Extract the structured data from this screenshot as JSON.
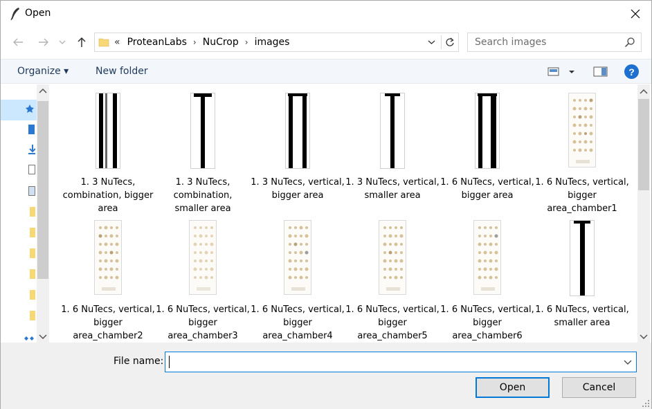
{
  "window": {
    "title": "Open",
    "app_icon": "feather-icon",
    "close_icon": "close-icon"
  },
  "address": {
    "prefix": "«",
    "crumbs": [
      "ProteanLabs",
      "NuCrop",
      "images"
    ],
    "separator": "›"
  },
  "search": {
    "placeholder": "Search images"
  },
  "toolbar": {
    "organize_label": "Organize ▾",
    "new_folder_label": "New folder",
    "help_label": "?"
  },
  "files": [
    {
      "name": "1. 3 NuTecs, combination, bigger area",
      "thumb": "double-bar"
    },
    {
      "name": "1. 3 NuTecs, combination, smaller area",
      "thumb": "single-bar"
    },
    {
      "name": "1. 3 NuTecs, vertical, bigger area",
      "thumb": "double-bar"
    },
    {
      "name": "1. 3 NuTecs, vertical, smaller area",
      "thumb": "single-bar"
    },
    {
      "name": "1. 6 NuTecs, vertical, bigger area",
      "thumb": "double-bar"
    },
    {
      "name": "1. 6 NuTecs, vertical, bigger area_chamber1",
      "thumb": "dots"
    },
    {
      "name": "1. 6 NuTecs, vertical, bigger area_chamber2",
      "thumb": "dots"
    },
    {
      "name": "1. 6 NuTecs, vertical, bigger area_chamber3",
      "thumb": "dots"
    },
    {
      "name": "1. 6 NuTecs, vertical, bigger area_chamber4",
      "thumb": "dots"
    },
    {
      "name": "1. 6 NuTecs, vertical, bigger area_chamber5",
      "thumb": "dots"
    },
    {
      "name": "1. 6 NuTecs, vertical, bigger area_chamber6",
      "thumb": "dots"
    },
    {
      "name": "1. 6 NuTecs, vertical, smaller area",
      "thumb": "single-bar"
    }
  ],
  "bottom": {
    "filename_label": "File name:",
    "filename_value": "",
    "open_label": "Open",
    "cancel_label": "Cancel"
  },
  "colors": {
    "accent": "#0078d7",
    "selection": "#cce8ff",
    "toolbar_bg": "#f3f6fa",
    "footer_bg": "#f0f0f0",
    "help_blue": "#1f6fd1"
  }
}
